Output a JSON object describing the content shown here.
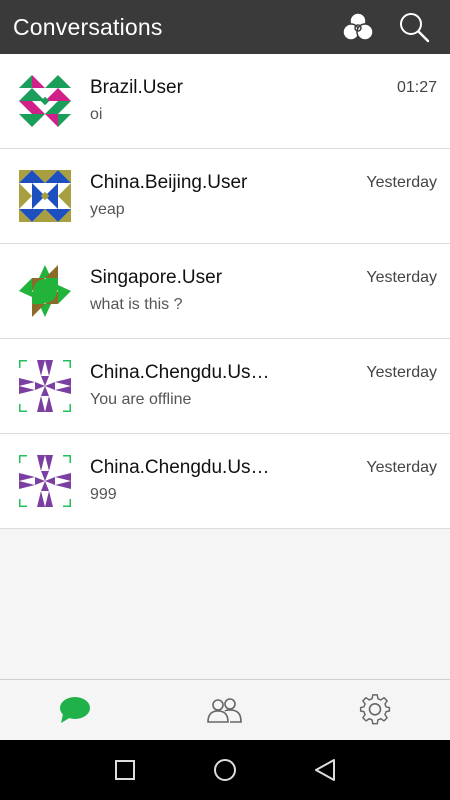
{
  "header": {
    "title": "Conversations",
    "icons": [
      "circles-icon",
      "search-icon"
    ]
  },
  "conversations": [
    {
      "name": "Brazil.User",
      "message": "oi",
      "time": "01:27",
      "avatar_colors": [
        "#1a9e5a",
        "#d0218a"
      ]
    },
    {
      "name": "China.Beijing.User",
      "message": "yeap",
      "time": "Yesterday",
      "avatar_colors": [
        "#1d4fbf",
        "#a8a040"
      ]
    },
    {
      "name": "Singapore.User",
      "message": "what is this ?",
      "time": "Yesterday",
      "avatar_colors": [
        "#21b33a",
        "#8c6b2a"
      ]
    },
    {
      "name": "China.Chengdu.Us…",
      "message": "You are offline",
      "time": "Yesterday",
      "avatar_colors": [
        "#7a3fa0",
        "#22c05a"
      ]
    },
    {
      "name": "China.Chengdu.Us…",
      "message": "999",
      "time": "Yesterday",
      "avatar_colors": [
        "#7a3fa0",
        "#22c05a"
      ]
    }
  ],
  "tabs": [
    {
      "icon": "chat-bubble-icon",
      "active": true
    },
    {
      "icon": "contacts-icon",
      "active": false
    },
    {
      "icon": "gear-icon",
      "active": false
    }
  ],
  "navbar": [
    "square-icon",
    "circle-icon",
    "back-triangle-icon"
  ],
  "colors": {
    "appbar": "#3a3a3a",
    "accent": "#21b14b",
    "background": "#f5f5f5"
  }
}
